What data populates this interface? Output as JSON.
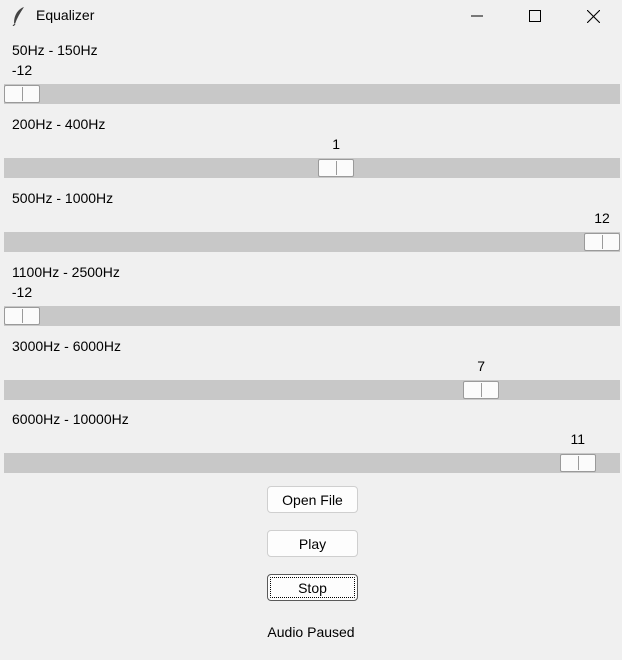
{
  "window": {
    "title": "Equalizer",
    "icon": "feather-icon",
    "controls": [
      "minimize-icon",
      "maximize-icon",
      "close-icon"
    ]
  },
  "bands": [
    {
      "label": "50Hz - 150Hz",
      "value": "-12",
      "level": 0.0
    },
    {
      "label": "200Hz - 400Hz",
      "value": "1",
      "level": 0.5417
    },
    {
      "label": "500Hz - 1000Hz",
      "value": "12",
      "level": 1.0
    },
    {
      "label": "1100Hz - 2500Hz",
      "value": "-12",
      "level": 0.0
    },
    {
      "label": "3000Hz - 6000Hz",
      "value": "7",
      "level": 0.7917
    },
    {
      "label": "6000Hz - 10000Hz",
      "value": "11",
      "level": 0.9583
    }
  ],
  "slider_range": {
    "min": -12,
    "max": 12
  },
  "buttons": {
    "open_file": "Open File",
    "play": "Play",
    "stop": "Stop"
  },
  "status": "Audio Paused"
}
